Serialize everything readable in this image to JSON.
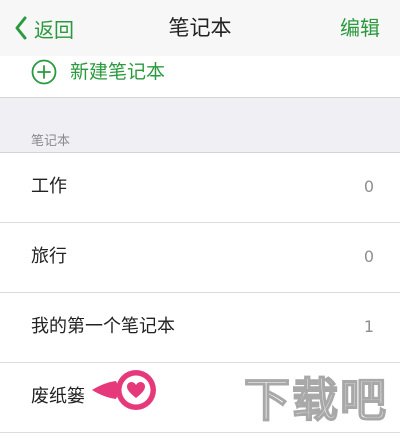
{
  "nav": {
    "back_label": "返回",
    "title": "笔记本",
    "edit_label": "编辑"
  },
  "new_notebook": {
    "label": "新建笔记本"
  },
  "section": {
    "header": "笔记本"
  },
  "notebooks": [
    {
      "name": "工作",
      "count": "0"
    },
    {
      "name": "旅行",
      "count": "0"
    },
    {
      "name": "我的第一个笔记本",
      "count": "1"
    },
    {
      "name": "废纸篓",
      "count": ""
    }
  ],
  "watermark": "下载吧",
  "colors": {
    "accent": "#2b9a3e",
    "heart_marker": "#e6397c",
    "background": "#efeff4"
  },
  "icons": {
    "back": "chevron-left-icon",
    "new": "plus-circle-icon",
    "marker": "heart-marker-icon"
  }
}
